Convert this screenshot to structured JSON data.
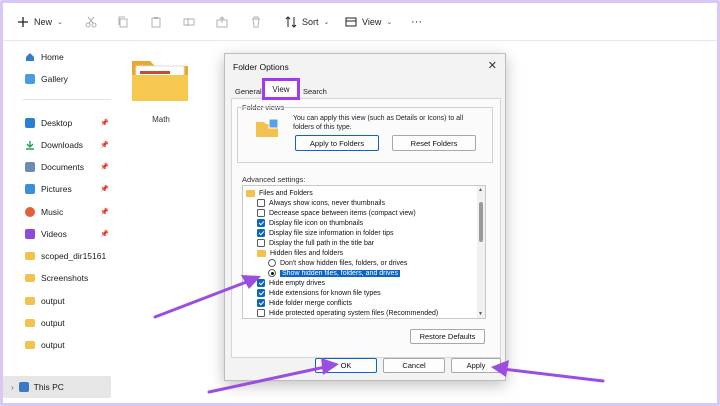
{
  "toolbar": {
    "new_label": "New",
    "sort_label": "Sort",
    "view_label": "View",
    "more_label": "···"
  },
  "sidebar": {
    "top_items": [
      {
        "label": "Home",
        "icon": "home-icon"
      },
      {
        "label": "Gallery",
        "icon": "gallery-icon"
      }
    ],
    "quick_items": [
      {
        "label": "Desktop",
        "icon": "desktop-icon",
        "color": "#2b7fd6"
      },
      {
        "label": "Downloads",
        "icon": "downloads-icon",
        "color": "#2aa05a"
      },
      {
        "label": "Documents",
        "icon": "documents-icon",
        "color": "#6c8cb0"
      },
      {
        "label": "Pictures",
        "icon": "pictures-icon",
        "color": "#3a8fd9"
      },
      {
        "label": "Music",
        "icon": "music-icon",
        "color": "#e0613a"
      },
      {
        "label": "Videos",
        "icon": "videos-icon",
        "color": "#8e4ad9"
      },
      {
        "label": "scoped_dir15161",
        "icon": "folder-icon",
        "color": "#f2c14e"
      },
      {
        "label": "Screenshots",
        "icon": "folder-icon",
        "color": "#f2c14e"
      },
      {
        "label": "output",
        "icon": "folder-icon",
        "color": "#f2c14e"
      },
      {
        "label": "output",
        "icon": "folder-icon",
        "color": "#f2c14e"
      },
      {
        "label": "output",
        "icon": "folder-icon",
        "color": "#f2c14e"
      }
    ],
    "this_pc_label": "This PC"
  },
  "main": {
    "folder_label": "Math"
  },
  "dialog": {
    "title": "Folder Options",
    "close": "✕",
    "tabs": [
      "General",
      "View",
      "Search"
    ],
    "folder_views_label": "Folder views",
    "folder_views_text": "You can apply this view (such as Details or Icons) to all folders of this type.",
    "apply_to_folders": "Apply to Folders",
    "reset_folders": "Reset Folders",
    "advanced_label": "Advanced settings:",
    "advanced_items": [
      {
        "type": "folder",
        "label": "Files and Folders",
        "indent": 0
      },
      {
        "type": "checkbox",
        "checked": false,
        "label": "Always show icons, never thumbnails",
        "indent": 1
      },
      {
        "type": "checkbox",
        "checked": false,
        "label": "Decrease space between items (compact view)",
        "indent": 1
      },
      {
        "type": "checkbox",
        "checked": true,
        "label": "Display file icon on thumbnails",
        "indent": 1
      },
      {
        "type": "checkbox",
        "checked": true,
        "label": "Display file size information in folder tips",
        "indent": 1
      },
      {
        "type": "checkbox",
        "checked": false,
        "label": "Display the full path in the title bar",
        "indent": 1
      },
      {
        "type": "folder",
        "label": "Hidden files and folders",
        "indent": 1
      },
      {
        "type": "radio",
        "checked": false,
        "label": "Don't show hidden files, folders, or drives",
        "indent": 2
      },
      {
        "type": "radio",
        "checked": true,
        "label": "Show hidden files, folders, and drives",
        "indent": 2,
        "selected": true
      },
      {
        "type": "checkbox",
        "checked": true,
        "label": "Hide empty drives",
        "indent": 1
      },
      {
        "type": "checkbox",
        "checked": true,
        "label": "Hide extensions for known file types",
        "indent": 1
      },
      {
        "type": "checkbox",
        "checked": true,
        "label": "Hide folder merge conflicts",
        "indent": 1
      },
      {
        "type": "checkbox",
        "checked": false,
        "label": "Hide protected operating system files (Recommended)",
        "indent": 1
      }
    ],
    "restore_defaults": "Restore Defaults",
    "ok": "OK",
    "cancel": "Cancel",
    "apply": "Apply"
  },
  "colors": {
    "accent": "#0a66c2",
    "highlight": "#a33af0",
    "arrow": "#9b4de0"
  }
}
